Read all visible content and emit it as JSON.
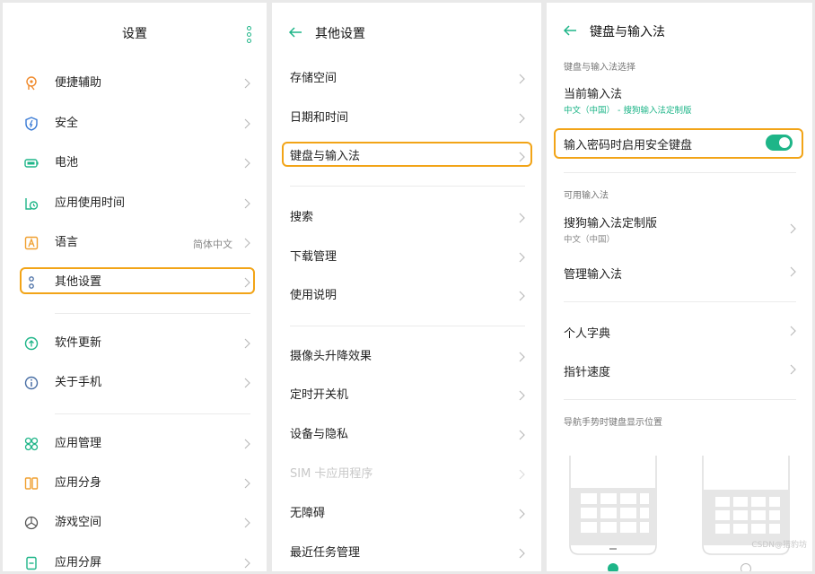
{
  "panel1": {
    "title": "设置",
    "items": [
      {
        "label": "便捷辅助",
        "icon": "hand-assist-icon"
      },
      {
        "label": "安全",
        "icon": "shield-icon"
      },
      {
        "label": "电池",
        "icon": "battery-icon"
      },
      {
        "label": "应用使用时间",
        "icon": "app-timer-icon"
      },
      {
        "label": "语言",
        "icon": "language-icon",
        "value": "简体中文"
      },
      {
        "label": "其他设置",
        "icon": "other-settings-icon",
        "highlighted": true
      },
      {
        "label": "软件更新",
        "icon": "update-icon"
      },
      {
        "label": "关于手机",
        "icon": "info-icon"
      },
      {
        "label": "应用管理",
        "icon": "app-manage-icon"
      },
      {
        "label": "应用分身",
        "icon": "app-clone-icon"
      },
      {
        "label": "游戏空间",
        "icon": "game-space-icon"
      },
      {
        "label": "应用分屏",
        "icon": "split-screen-icon"
      }
    ]
  },
  "panel2": {
    "title": "其他设置",
    "items": [
      {
        "label": "存储空间"
      },
      {
        "label": "日期和时间"
      },
      {
        "label": "键盘与输入法",
        "highlighted": true
      },
      {
        "label": "搜索"
      },
      {
        "label": "下载管理"
      },
      {
        "label": "使用说明"
      },
      {
        "label": "摄像头升降效果"
      },
      {
        "label": "定时开关机"
      },
      {
        "label": "设备与隐私"
      },
      {
        "label": "SIM 卡应用程序",
        "disabled": true
      },
      {
        "label": "无障碍"
      },
      {
        "label": "最近任务管理"
      }
    ]
  },
  "panel3": {
    "title": "键盘与输入法",
    "section1": "键盘与输入法选择",
    "current_ime": {
      "label": "当前输入法",
      "sub": "中文（中国） - 搜狗输入法定制版"
    },
    "secure_keyboard": {
      "label": "输入密码时启用安全键盘",
      "on": true
    },
    "section2": "可用输入法",
    "sogou": {
      "label": "搜狗输入法定制版",
      "sub": "中文（中国）"
    },
    "manage": {
      "label": "管理输入法"
    },
    "dictionary": {
      "label": "个人字典"
    },
    "pointer_speed": {
      "label": "指针速度"
    },
    "section3": "导航手势时键盘显示位置"
  },
  "watermark": "CSDN@猎豹坊",
  "colors": {
    "accent": "#1eb588",
    "highlight": "#f2a417",
    "background": "#e9e9e9"
  }
}
